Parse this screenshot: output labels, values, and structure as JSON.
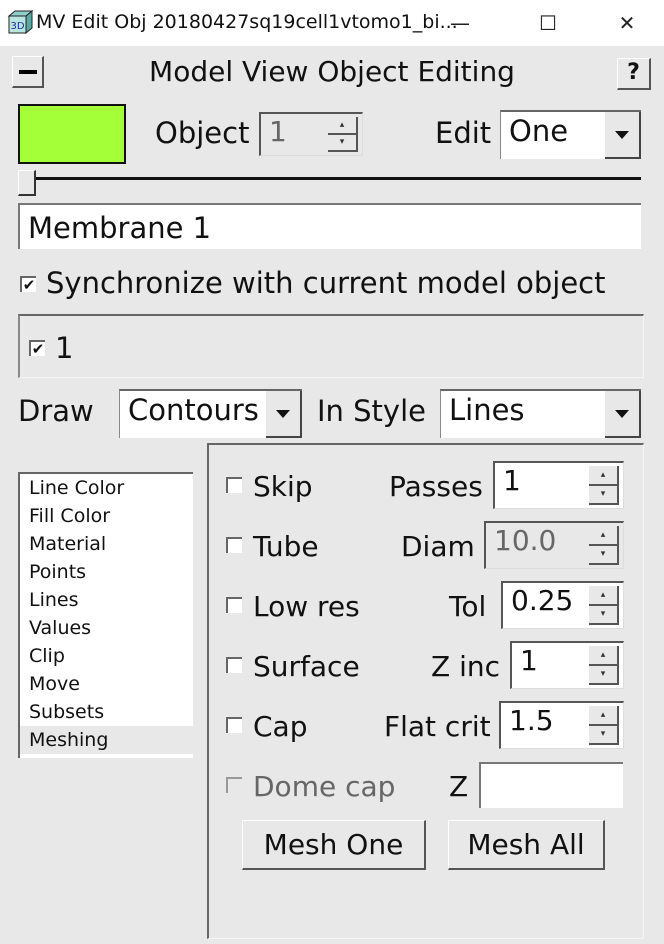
{
  "window": {
    "title": "MV Edit Obj 20180427sq19cell1vtomo1_bi...",
    "app_icon_label": "3D",
    "minimize_glyph": "—",
    "maximize_glyph": "☐",
    "close_glyph": "✕"
  },
  "header": {
    "title": "Model View Object Editing",
    "help_label": "?"
  },
  "object_row": {
    "swatch_color": "#a4ff38",
    "object_label": "Object",
    "object_value": "1",
    "edit_label": "Edit",
    "edit_value": "One"
  },
  "slider": {
    "value_fraction": 0.0
  },
  "name_field": {
    "value": "Membrane 1"
  },
  "sync": {
    "label": "Synchronize with current model object",
    "checked": true
  },
  "objects_group": {
    "items": [
      {
        "label": "1",
        "checked": true
      }
    ]
  },
  "draw_row": {
    "draw_label": "Draw",
    "draw_value": "Contours",
    "style_label": "In Style",
    "style_value": "Lines"
  },
  "category_list": {
    "items": [
      "Line Color",
      "Fill Color",
      "Material",
      "Points",
      "Lines",
      "Values",
      "Clip",
      "Move",
      "Subsets",
      "Meshing"
    ],
    "selected": "Meshing"
  },
  "meshing": {
    "options": [
      {
        "label": "Skip",
        "checked": false,
        "enabled": true
      },
      {
        "label": "Tube",
        "checked": false,
        "enabled": true
      },
      {
        "label": "Low res",
        "checked": false,
        "enabled": true
      },
      {
        "label": "Surface",
        "checked": false,
        "enabled": true
      },
      {
        "label": "Cap",
        "checked": false,
        "enabled": true
      },
      {
        "label": "Dome cap",
        "checked": false,
        "enabled": false
      }
    ],
    "fields": [
      {
        "label": "Passes",
        "value": "1",
        "enabled": true
      },
      {
        "label": "Diam",
        "value": "10.0",
        "enabled": false
      },
      {
        "label": "Tol",
        "value": "0.25",
        "enabled": true
      },
      {
        "label": "Z inc",
        "value": "1",
        "enabled": true
      },
      {
        "label": "Flat crit",
        "value": "1.5",
        "enabled": true
      },
      {
        "label": "Z",
        "value": "",
        "enabled": true
      }
    ],
    "mesh_one_label": "Mesh One",
    "mesh_all_label": "Mesh All"
  },
  "glyphs": {
    "check": "✔",
    "spin_up": "▴",
    "spin_down": "▾"
  }
}
